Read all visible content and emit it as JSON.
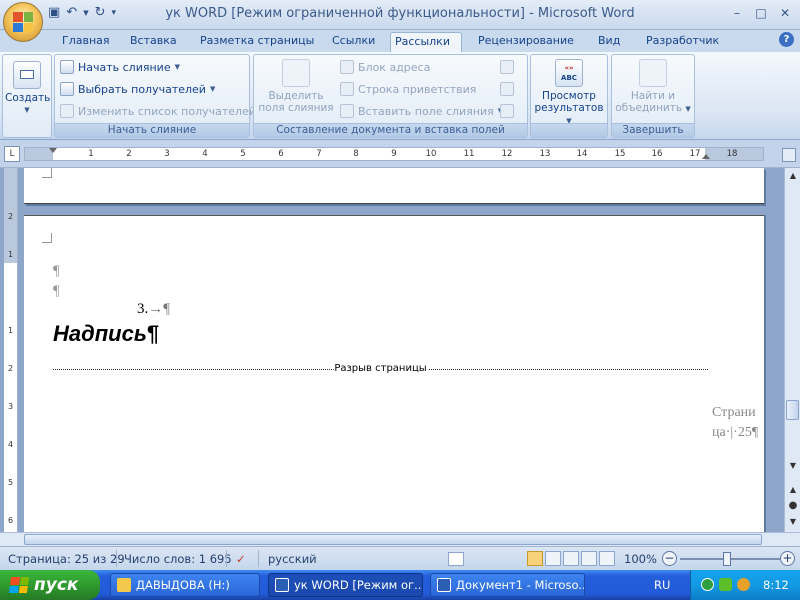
{
  "window": {
    "title": "ук WORD [Режим ограниченной функциональности] - Microsoft Word",
    "controls": [
      "–",
      "□",
      "✕"
    ]
  },
  "tabs": [
    "Главная",
    "Вставка",
    "Разметка страницы",
    "Ссылки",
    "Рассылки",
    "Рецензирование",
    "Вид",
    "Разработчик"
  ],
  "active_tab": "Рассылки",
  "ribbon": {
    "create_label": "Создать",
    "start_merge": {
      "btn_start": "Начать слияние",
      "btn_recipients": "Выбрать получателей",
      "btn_edit_list": "Изменить список получателей",
      "group_label": "Начать слияние"
    },
    "compose": {
      "highlight_line1": "Выделить",
      "highlight_line2": "поля слияния",
      "address_block": "Блок адреса",
      "greeting_line": "Строка приветствия",
      "insert_field": "Вставить поле слияния",
      "group_label": "Составление документа и вставка полей"
    },
    "preview": {
      "line1": "Просмотр",
      "line2": "результатов",
      "abc_badge": "ABC",
      "chevron": "«»"
    },
    "finish": {
      "line1": "Найти и",
      "line2": "объединить",
      "group_label": "Завершить"
    }
  },
  "ruler": {
    "corner": "L",
    "numbers": [
      "1",
      "2",
      "3",
      "4",
      "5",
      "6",
      "7",
      "8",
      "9",
      "10",
      "11",
      "12",
      "13",
      "14",
      "15",
      "16",
      "17",
      "18"
    ],
    "vnumbers": [
      "2",
      "1",
      "1",
      "2",
      "3",
      "4",
      "5",
      "6"
    ]
  },
  "document": {
    "pilcrow": "¶",
    "numbered_text": "3.",
    "tab_mark": "→",
    "heading": "Надпись",
    "page_break_label": "Разрыв страницы",
    "margin_note_line1": "Страни",
    "margin_note_line2": "ца·|·25¶"
  },
  "status": {
    "page": "Страница: 25 из 29",
    "words": "Число слов: 1 695",
    "language": "русский",
    "zoom": "100%"
  },
  "taskbar": {
    "start": "пуск",
    "tasks": [
      "ДАВЫДОВА (H:)",
      "ук WORD [Режим ог...",
      "Документ1 - Microso..."
    ],
    "lang": "RU",
    "clock": "8:12"
  },
  "colors": {
    "ribbon_text": "#15428b",
    "taskbar_blue": "#245edb",
    "start_green": "#2f9a2f",
    "tray_blue": "#129ae3"
  }
}
